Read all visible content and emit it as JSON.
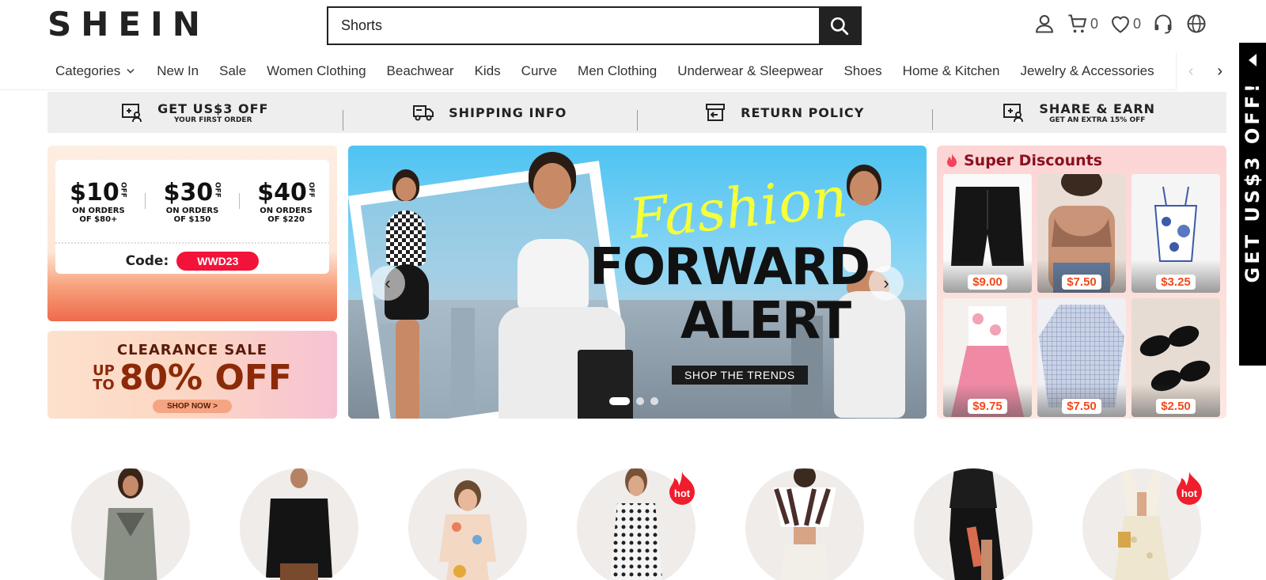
{
  "header": {
    "logo": "SHEIN",
    "search_value": "Shorts",
    "cart_count": "0",
    "wishlist_count": "0"
  },
  "nav": {
    "items": [
      "Categories",
      "New In",
      "Sale",
      "Women Clothing",
      "Beachwear",
      "Kids",
      "Curve",
      "Men Clothing",
      "Underwear & Sleepwear",
      "Shoes",
      "Home & Kitchen",
      "Jewelry & Accessories"
    ]
  },
  "strip": [
    {
      "title": "GET US$3 OFF",
      "sub": "YOUR FIRST ORDER"
    },
    {
      "title": "SHIPPING INFO",
      "sub": ""
    },
    {
      "title": "RETURN POLICY",
      "sub": ""
    },
    {
      "title": "SHARE & EARN",
      "sub": "GET AN EXTRA 15% OFF"
    }
  ],
  "coupons": {
    "items": [
      {
        "amount": "$10",
        "off": "OFF",
        "cond1": "ON ORDERS",
        "cond2": "OF $80+"
      },
      {
        "amount": "$30",
        "off": "OFF",
        "cond1": "ON ORDERS",
        "cond2": "OF $150"
      },
      {
        "amount": "$40",
        "off": "OFF",
        "cond1": "ON ORDERS",
        "cond2": "OF $220"
      }
    ],
    "code_label": "Code:",
    "code": "WWD23"
  },
  "clearance": {
    "title": "CLEARANCE SALE",
    "upto_1": "UP",
    "upto_2": "TO",
    "pct": "80% OFF",
    "button": "SHOP NOW >"
  },
  "hero": {
    "script": "Fashion",
    "line1": "FORWARD",
    "line2": "ALERT",
    "cta": "SHOP THE TRENDS",
    "slides": 3,
    "active_slide": 1
  },
  "super": {
    "title": "Super Discounts",
    "products": [
      {
        "price": "$9.00"
      },
      {
        "price": "$7.50"
      },
      {
        "price": "$3.25"
      },
      {
        "price": "$9.75"
      },
      {
        "price": "$7.50"
      },
      {
        "price": "$2.50"
      }
    ]
  },
  "sidetab": {
    "label": "GET US$3 OFF!"
  },
  "categories": {
    "hot_badge": "hot"
  },
  "colors": {
    "brand": "#222222",
    "code_badge": "#f3133a",
    "price": "#f04a1e",
    "super_title": "#8a1020"
  }
}
